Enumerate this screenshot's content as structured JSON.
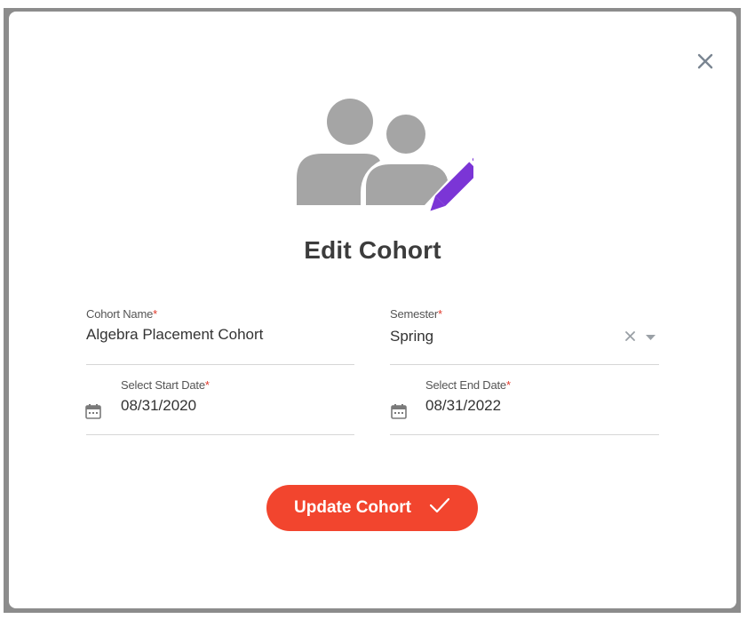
{
  "modal": {
    "title": "Edit Cohort",
    "close_icon": "close-icon",
    "hero_icon": "group-edit-icon",
    "accent_colors": {
      "button": "#f2452e",
      "pencil": "#7b35d6",
      "required": "#e0382a",
      "people": "#a5a5a5"
    }
  },
  "form": {
    "required_mark": "*",
    "cohort_name": {
      "label": "Cohort Name",
      "value": "Algebra Placement Cohort"
    },
    "semester": {
      "label": "Semester",
      "value": "Spring"
    },
    "start_date": {
      "label": "Select Start Date",
      "value": "08/31/2020",
      "icon": "calendar-icon"
    },
    "end_date": {
      "label": "Select End Date",
      "value": "08/31/2022",
      "icon": "calendar-icon"
    }
  },
  "actions": {
    "submit_label": "Update Cohort",
    "submit_icon": "check-icon"
  }
}
